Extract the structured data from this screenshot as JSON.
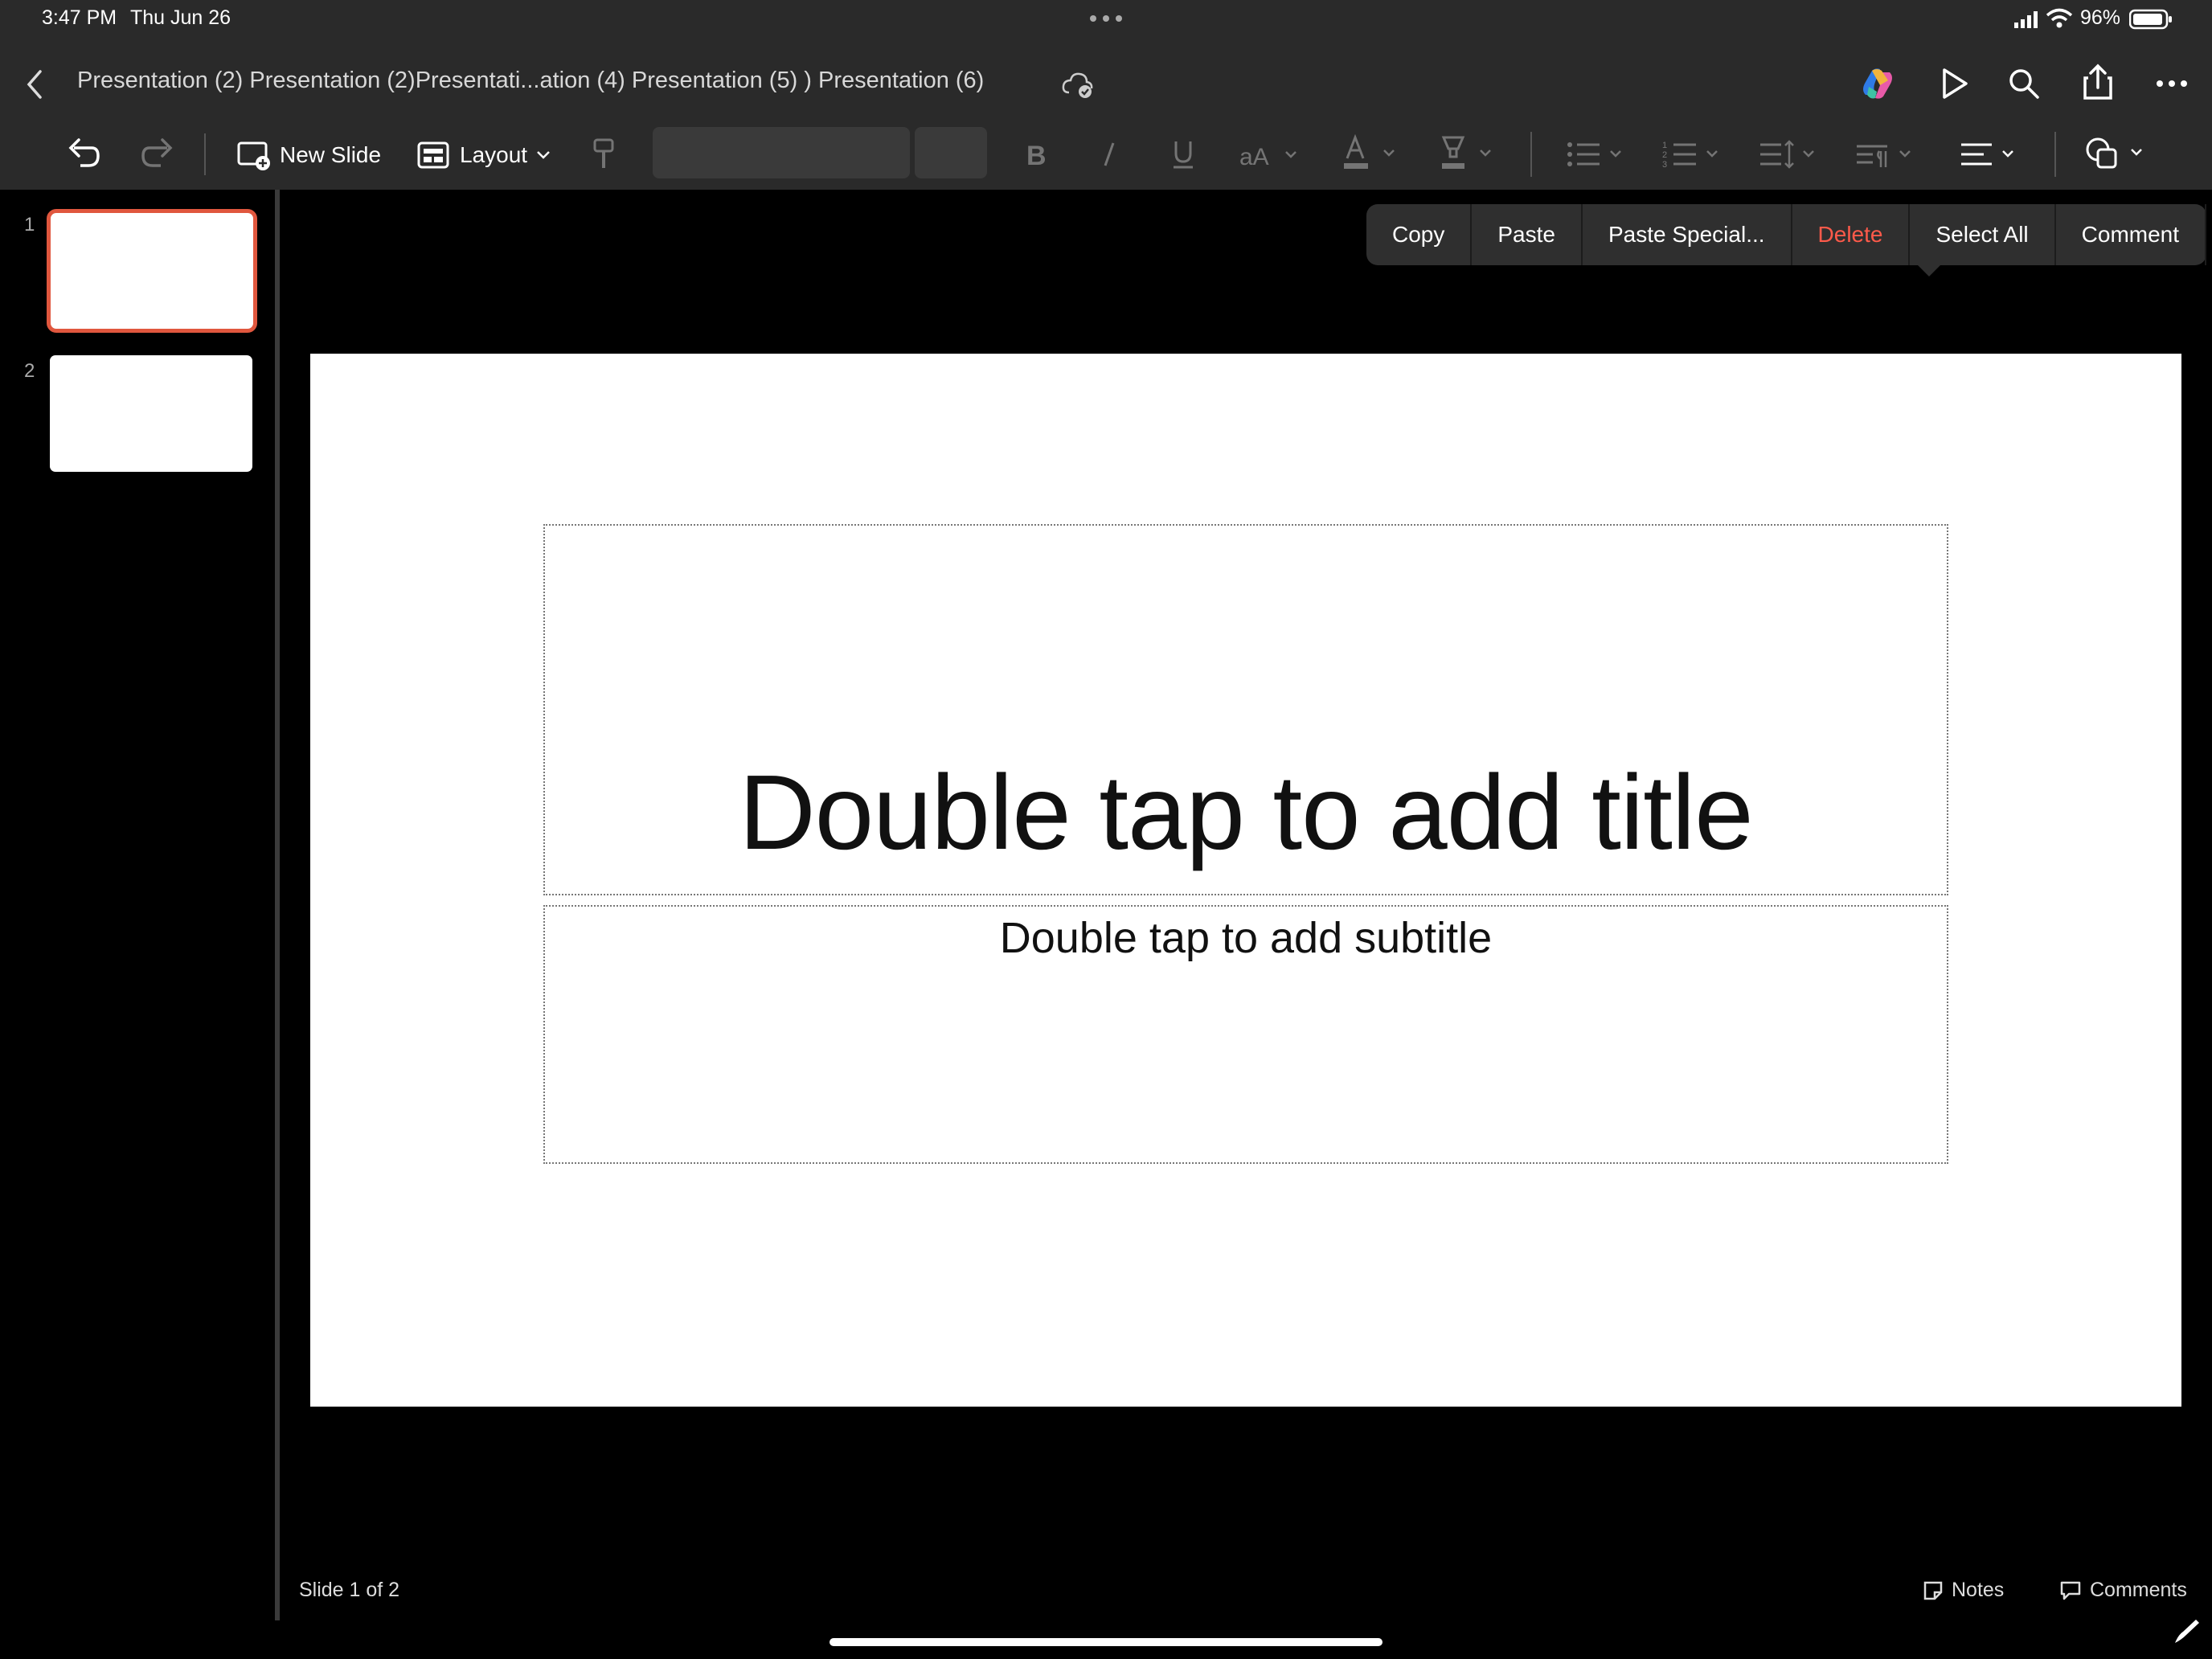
{
  "status_bar": {
    "time": "3:47 PM",
    "date": "Thu Jun 26",
    "battery": "96%"
  },
  "header": {
    "document_title": "Presentation (2) Presentation (2)Presentati...ation (4) Presentation (5) ) Presentation (6)"
  },
  "toolbar": {
    "new_slide_label": "New Slide",
    "layout_label": "Layout"
  },
  "context_menu": {
    "items": [
      {
        "label": "Copy"
      },
      {
        "label": "Paste"
      },
      {
        "label": "Paste Special..."
      },
      {
        "label": "Delete"
      },
      {
        "label": "Select All"
      },
      {
        "label": "Comment"
      }
    ]
  },
  "sidebar": {
    "thumbnails": [
      {
        "number": "1",
        "selected": true
      },
      {
        "number": "2",
        "selected": false
      }
    ]
  },
  "slide": {
    "title_placeholder": "Double tap to add title",
    "subtitle_placeholder": "Double tap to add subtitle"
  },
  "footer": {
    "slide_indicator": "Slide 1 of 2",
    "notes_label": "Notes",
    "comments_label": "Comments"
  },
  "colors": {
    "accent": "#e0573e",
    "delete_red": "#ff5a4a",
    "toolbar_bg": "#2a2a2a"
  }
}
